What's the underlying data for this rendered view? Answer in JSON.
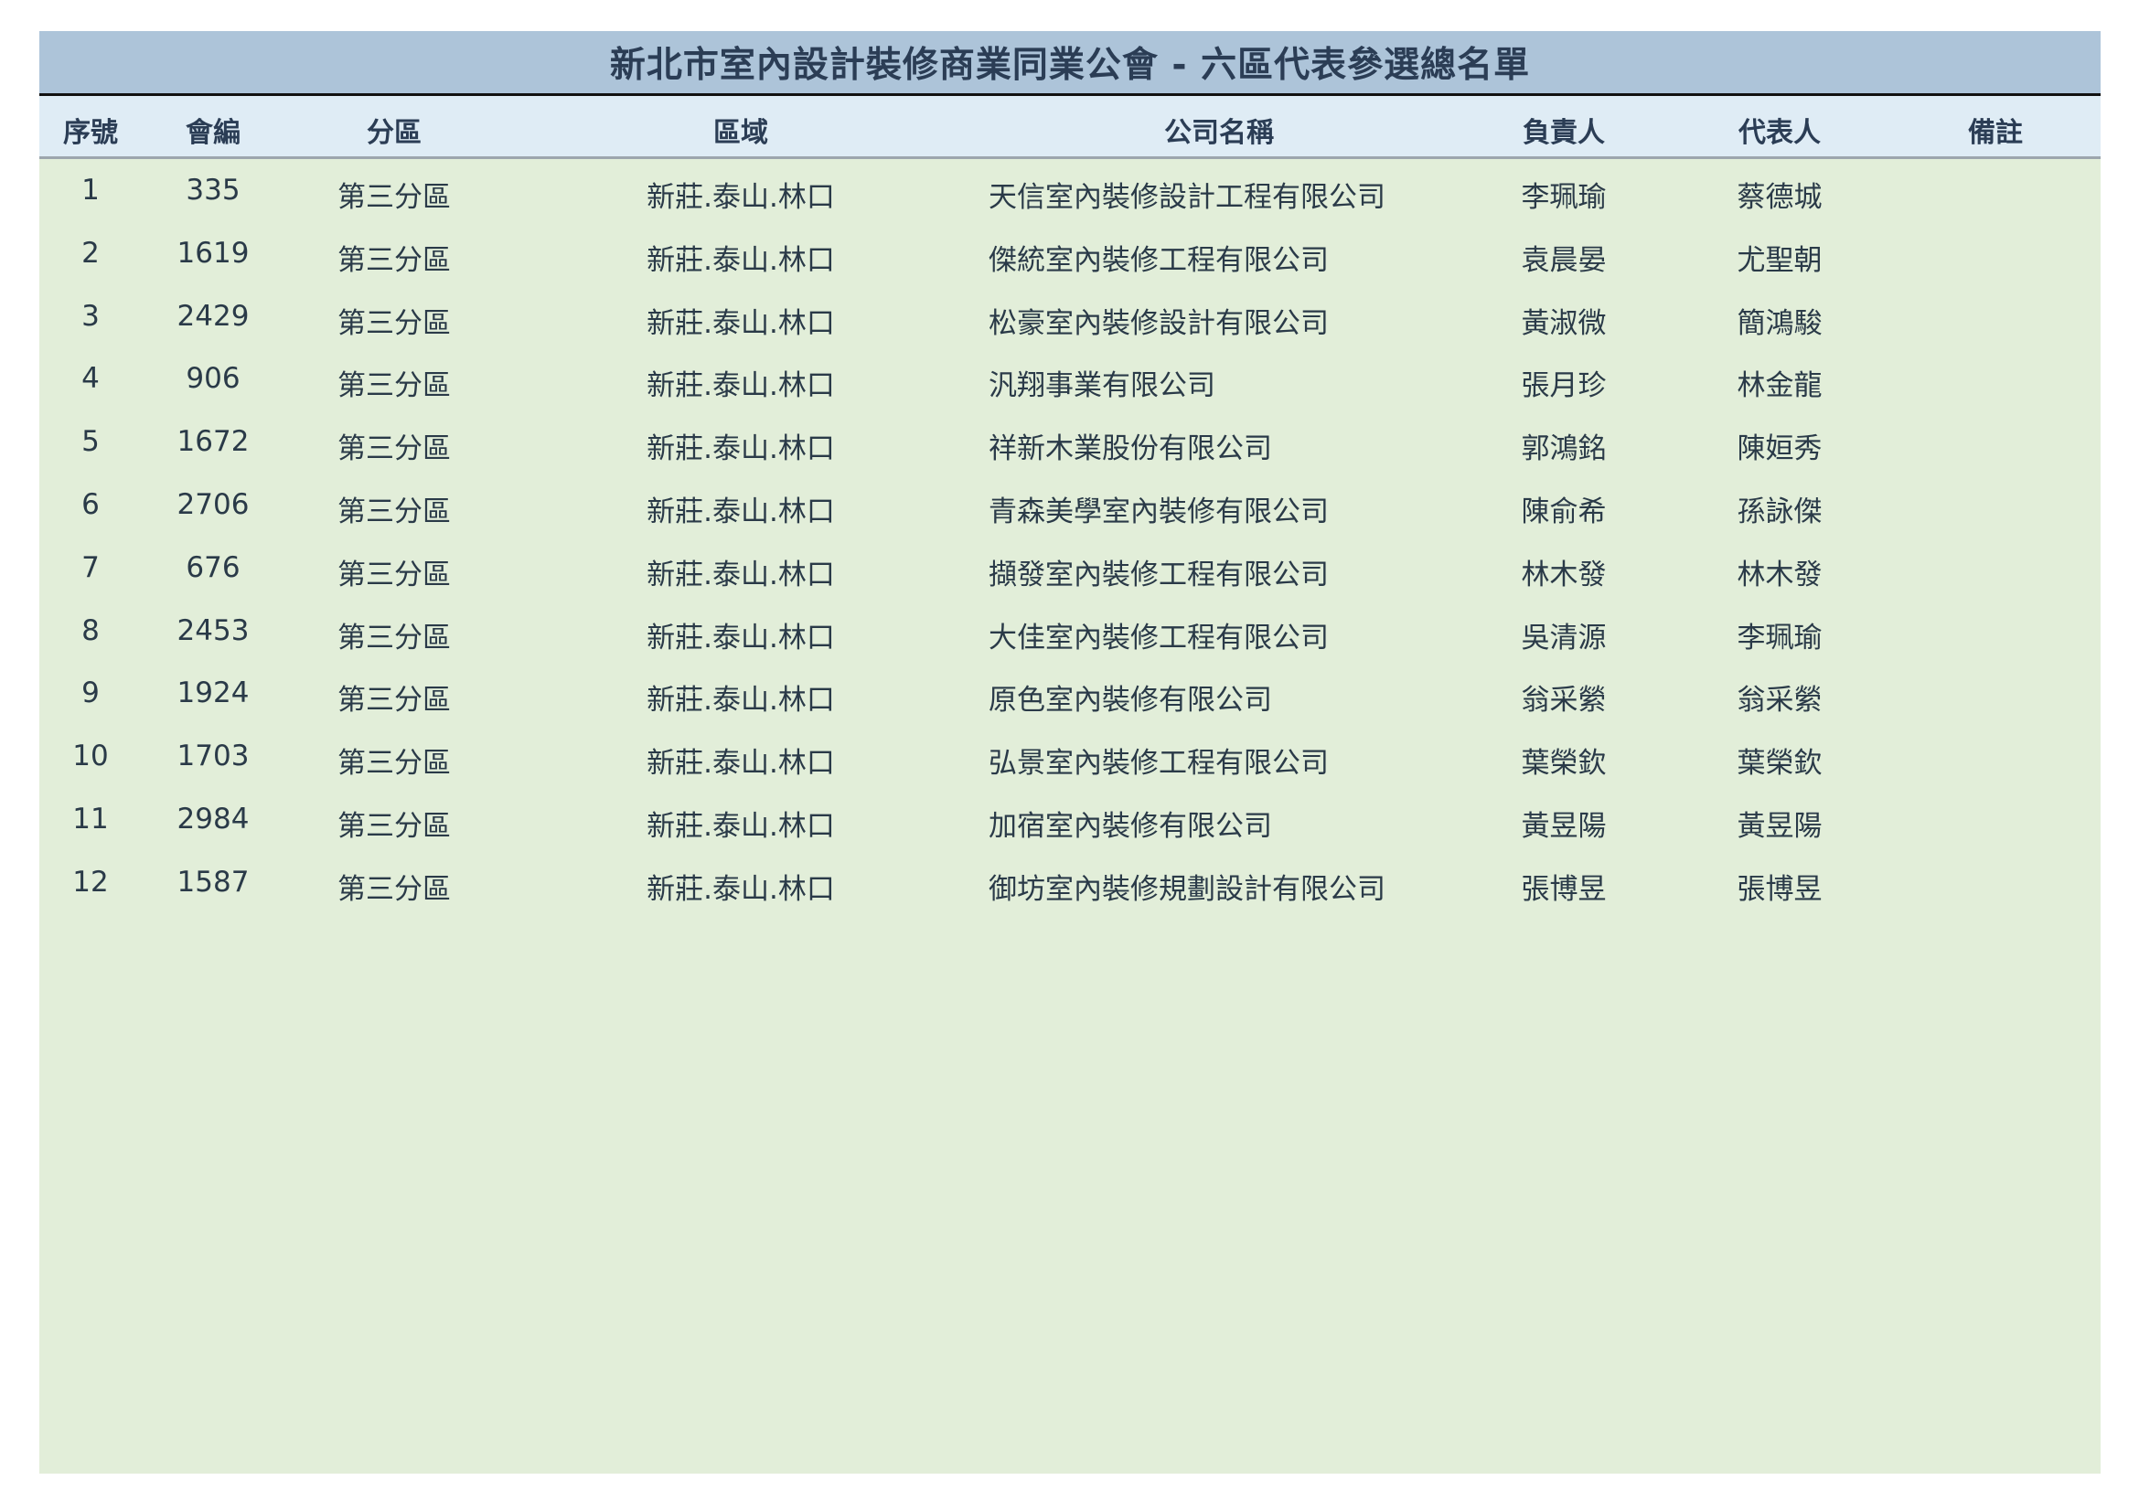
{
  "title": "新北市室內設計裝修商業同業公會 - 六區代表參選總名單",
  "columns": {
    "seq": "序號",
    "member_no": "會編",
    "division": "分區",
    "area": "區域",
    "company": "公司名稱",
    "owner": "負責人",
    "representative": "代表人",
    "note": "備註"
  },
  "rows": [
    {
      "seq": "1",
      "member_no": "335",
      "division": "第三分區",
      "area": "新莊.泰山.林口",
      "company": "天信室內裝修設計工程有限公司",
      "owner": "李珮瑜",
      "representative": "蔡德城",
      "note": ""
    },
    {
      "seq": "2",
      "member_no": "1619",
      "division": "第三分區",
      "area": "新莊.泰山.林口",
      "company": "傑統室內裝修工程有限公司",
      "owner": "袁晨晏",
      "representative": "尤聖朝",
      "note": ""
    },
    {
      "seq": "3",
      "member_no": "2429",
      "division": "第三分區",
      "area": "新莊.泰山.林口",
      "company": "松豪室內裝修設計有限公司",
      "owner": "黃淑微",
      "representative": "簡鴻駿",
      "note": ""
    },
    {
      "seq": "4",
      "member_no": "906",
      "division": "第三分區",
      "area": "新莊.泰山.林口",
      "company": "汎翔事業有限公司",
      "owner": "張月珍",
      "representative": "林金龍",
      "note": ""
    },
    {
      "seq": "5",
      "member_no": "1672",
      "division": "第三分區",
      "area": "新莊.泰山.林口",
      "company": "祥新木業股份有限公司",
      "owner": "郭鴻銘",
      "representative": "陳姮秀",
      "note": ""
    },
    {
      "seq": "6",
      "member_no": "2706",
      "division": "第三分區",
      "area": "新莊.泰山.林口",
      "company": "青森美學室內裝修有限公司",
      "owner": "陳俞希",
      "representative": "孫詠傑",
      "note": ""
    },
    {
      "seq": "7",
      "member_no": "676",
      "division": "第三分區",
      "area": "新莊.泰山.林口",
      "company": "擷發室內裝修工程有限公司",
      "owner": "林木發",
      "representative": "林木發",
      "note": ""
    },
    {
      "seq": "8",
      "member_no": "2453",
      "division": "第三分區",
      "area": "新莊.泰山.林口",
      "company": "大佳室內裝修工程有限公司",
      "owner": "吳清源",
      "representative": "李珮瑜",
      "note": ""
    },
    {
      "seq": "9",
      "member_no": "1924",
      "division": "第三分區",
      "area": "新莊.泰山.林口",
      "company": "原色室內裝修有限公司",
      "owner": "翁采縈",
      "representative": "翁采縈",
      "note": ""
    },
    {
      "seq": "10",
      "member_no": "1703",
      "division": "第三分區",
      "area": "新莊.泰山.林口",
      "company": "弘景室內裝修工程有限公司",
      "owner": "葉榮欽",
      "representative": "葉榮欽",
      "note": ""
    },
    {
      "seq": "11",
      "member_no": "2984",
      "division": "第三分區",
      "area": "新莊.泰山.林口",
      "company": "加宿室內裝修有限公司",
      "owner": "黃昱陽",
      "representative": "黃昱陽",
      "note": ""
    },
    {
      "seq": "12",
      "member_no": "1587",
      "division": "第三分區",
      "area": "新莊.泰山.林口",
      "company": "御坊室內裝修規劃設計有限公司",
      "owner": "張博昱",
      "representative": "張博昱",
      "note": ""
    }
  ],
  "colors": {
    "title_bg": "#adc4d9",
    "header_bg": "#dfecf5",
    "body_bg": "#e2eed9",
    "text": "#2b3d55"
  }
}
